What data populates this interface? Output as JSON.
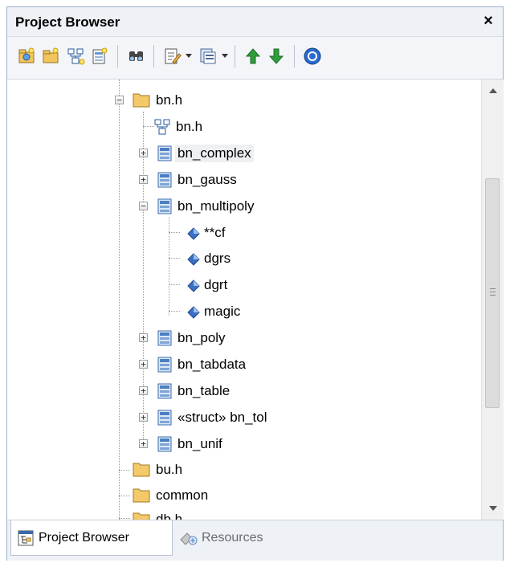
{
  "window": {
    "title": "Project Browser",
    "close_glyph": "×"
  },
  "toolbar": {
    "buttons": [
      {
        "name": "new-model-icon"
      },
      {
        "name": "new-package-icon"
      },
      {
        "name": "new-diagram-icon"
      },
      {
        "name": "new-element-icon"
      },
      {
        "name": "find-icon"
      },
      {
        "name": "properties-icon"
      },
      {
        "name": "options-icon"
      },
      {
        "name": "move-up-icon"
      },
      {
        "name": "move-down-icon"
      },
      {
        "name": "help-icon"
      }
    ]
  },
  "tree": {
    "items": [
      {
        "label": "bn.h",
        "icon": "folder-icon",
        "expander": "−"
      },
      {
        "label": "bn.h",
        "icon": "diagram-icon"
      },
      {
        "label": "bn_complex",
        "icon": "class-icon",
        "expander": "+",
        "selected": true
      },
      {
        "label": "bn_gauss",
        "icon": "class-icon",
        "expander": "+"
      },
      {
        "label": "bn_multipoly",
        "icon": "class-icon",
        "expander": "−"
      },
      {
        "label": "**cf",
        "icon": "attribute-icon"
      },
      {
        "label": "dgrs",
        "icon": "attribute-icon"
      },
      {
        "label": "dgrt",
        "icon": "attribute-icon"
      },
      {
        "label": "magic",
        "icon": "attribute-icon"
      },
      {
        "label": "bn_poly",
        "icon": "class-icon",
        "expander": "+"
      },
      {
        "label": "bn_tabdata",
        "icon": "class-icon",
        "expander": "+"
      },
      {
        "label": "bn_table",
        "icon": "class-icon",
        "expander": "+"
      },
      {
        "label": "«struct» bn_tol",
        "icon": "class-icon",
        "expander": "+"
      },
      {
        "label": "bn_unif",
        "icon": "class-icon",
        "expander": "+"
      },
      {
        "label": "bu.h",
        "icon": "folder-icon"
      },
      {
        "label": "common",
        "icon": "folder-icon"
      },
      {
        "label": "db.h",
        "icon": "folder-icon"
      }
    ]
  },
  "tabs": [
    {
      "label": "Project Browser",
      "icon": "project-browser-icon",
      "active": true
    },
    {
      "label": "Resources",
      "icon": "resources-icon",
      "active": false
    }
  ],
  "colors": {
    "folder": "#f4c96a",
    "class": "#4b7fc2",
    "attribute": "#3a6fc4",
    "move_up": "#2f9e3a",
    "move_down": "#2f9e3a",
    "help": "#2a6ad0"
  }
}
